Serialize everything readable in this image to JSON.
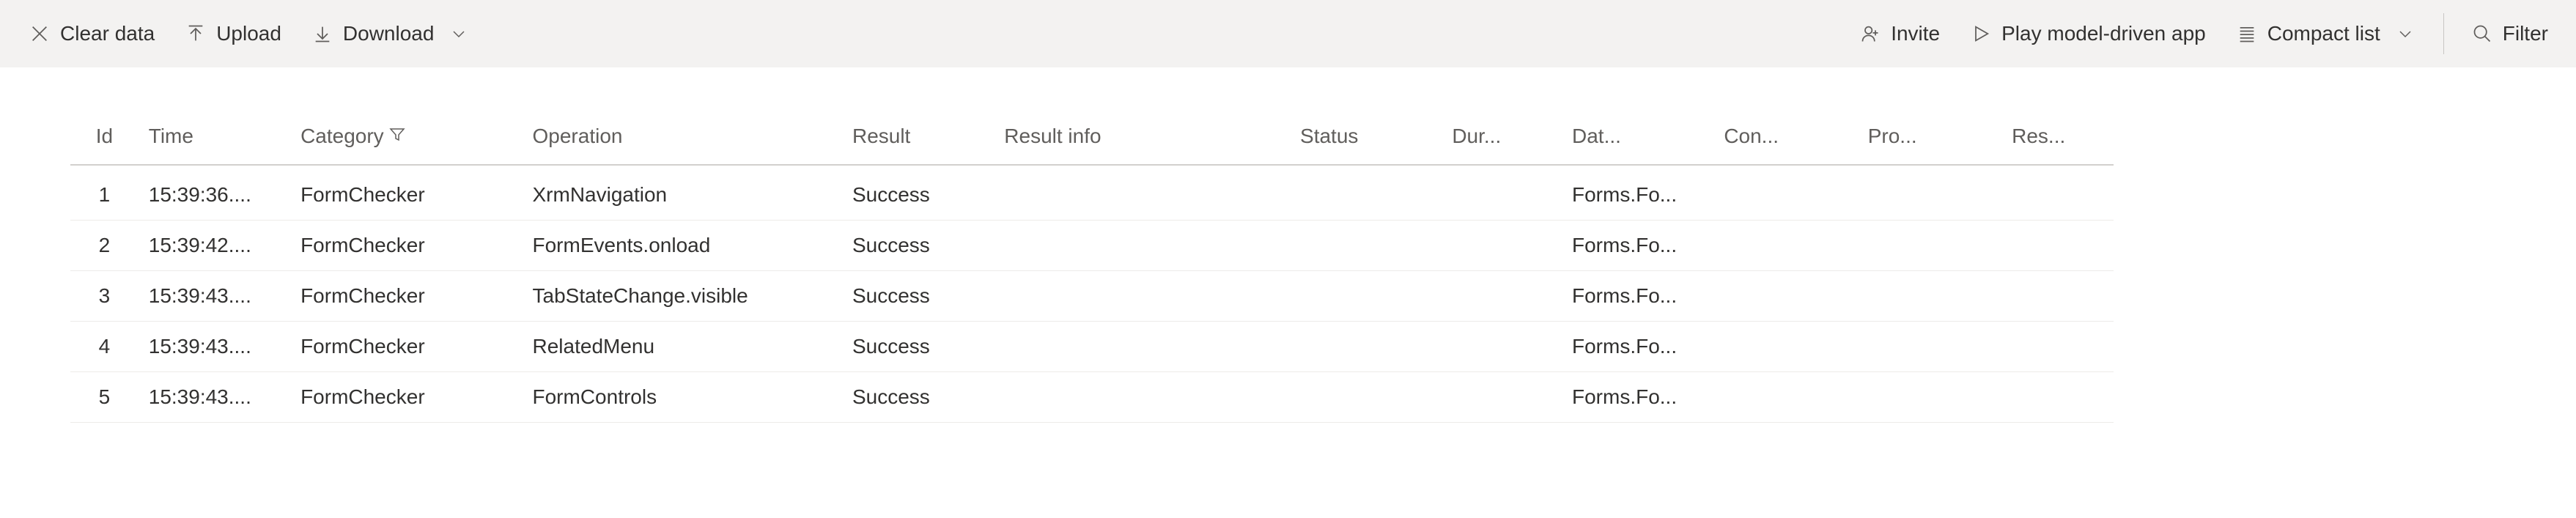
{
  "toolbar": {
    "left": {
      "clear_data": "Clear data",
      "upload": "Upload",
      "download": "Download"
    },
    "right": {
      "invite": "Invite",
      "play_app": "Play model-driven app",
      "compact_list": "Compact list",
      "filter": "Filter"
    }
  },
  "table": {
    "headers": {
      "id": "Id",
      "time": "Time",
      "category": "Category",
      "operation": "Operation",
      "result": "Result",
      "result_info": "Result info",
      "status": "Status",
      "duration": "Dur...",
      "data": "Dat...",
      "conn": "Con...",
      "prop": "Pro...",
      "res": "Res..."
    },
    "rows": [
      {
        "id": "1",
        "time": "15:39:36....",
        "category": "FormChecker",
        "operation": "XrmNavigation",
        "result": "Success",
        "result_info": "",
        "status": "",
        "duration": "",
        "data": "Forms.Fo...",
        "conn": "",
        "prop": "",
        "res": ""
      },
      {
        "id": "2",
        "time": "15:39:42....",
        "category": "FormChecker",
        "operation": "FormEvents.onload",
        "result": "Success",
        "result_info": "",
        "status": "",
        "duration": "",
        "data": "Forms.Fo...",
        "conn": "",
        "prop": "",
        "res": ""
      },
      {
        "id": "3",
        "time": "15:39:43....",
        "category": "FormChecker",
        "operation": "TabStateChange.visible",
        "result": "Success",
        "result_info": "",
        "status": "",
        "duration": "",
        "data": "Forms.Fo...",
        "conn": "",
        "prop": "",
        "res": ""
      },
      {
        "id": "4",
        "time": "15:39:43....",
        "category": "FormChecker",
        "operation": "RelatedMenu",
        "result": "Success",
        "result_info": "",
        "status": "",
        "duration": "",
        "data": "Forms.Fo...",
        "conn": "",
        "prop": "",
        "res": ""
      },
      {
        "id": "5",
        "time": "15:39:43....",
        "category": "FormChecker",
        "operation": "FormControls",
        "result": "Success",
        "result_info": "",
        "status": "",
        "duration": "",
        "data": "Forms.Fo...",
        "conn": "",
        "prop": "",
        "res": ""
      }
    ]
  }
}
